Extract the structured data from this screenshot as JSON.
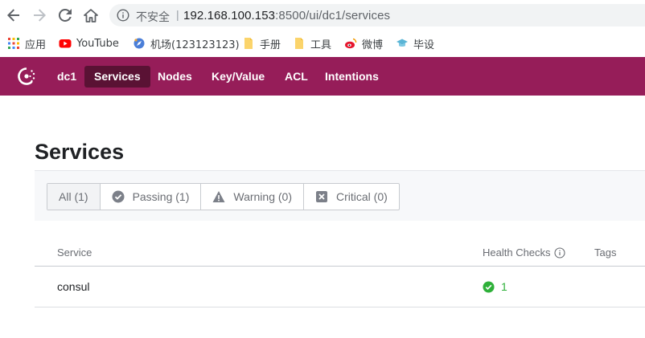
{
  "browser": {
    "security_text": "不安全",
    "url_host": "192.168.100.153",
    "url_rest": ":8500/ui/dc1/services"
  },
  "bookmarks": [
    {
      "label": "应用",
      "icon": "apps-grid-icon"
    },
    {
      "label": "YouTube",
      "icon": "youtube-icon"
    },
    {
      "label": "机场(123123123)",
      "icon": "rocket-icon"
    },
    {
      "label": "手册",
      "icon": "folder-icon"
    },
    {
      "label": "工具",
      "icon": "folder-icon"
    },
    {
      "label": "微博",
      "icon": "weibo-icon"
    },
    {
      "label": "毕设",
      "icon": "hat-icon"
    }
  ],
  "nav": {
    "datacenter": "dc1",
    "items": [
      {
        "label": "Services",
        "active": true
      },
      {
        "label": "Nodes",
        "active": false
      },
      {
        "label": "Key/Value",
        "active": false
      },
      {
        "label": "ACL",
        "active": false
      },
      {
        "label": "Intentions",
        "active": false
      }
    ]
  },
  "page": {
    "title": "Services"
  },
  "filters": [
    {
      "label": "All (1)",
      "icon": "",
      "selected": true
    },
    {
      "label": "Passing (1)",
      "icon": "check-circle-icon",
      "selected": false
    },
    {
      "label": "Warning (0)",
      "icon": "warning-triangle-icon",
      "selected": false
    },
    {
      "label": "Critical (0)",
      "icon": "critical-x-icon",
      "selected": false
    }
  ],
  "table": {
    "headers": {
      "service": "Service",
      "health": "Health Checks",
      "tags": "Tags"
    },
    "rows": [
      {
        "service": "consul",
        "passing": "1"
      }
    ]
  },
  "colors": {
    "brand": "#961d59",
    "brand_active": "#5a1234",
    "passing": "#2eb039"
  }
}
